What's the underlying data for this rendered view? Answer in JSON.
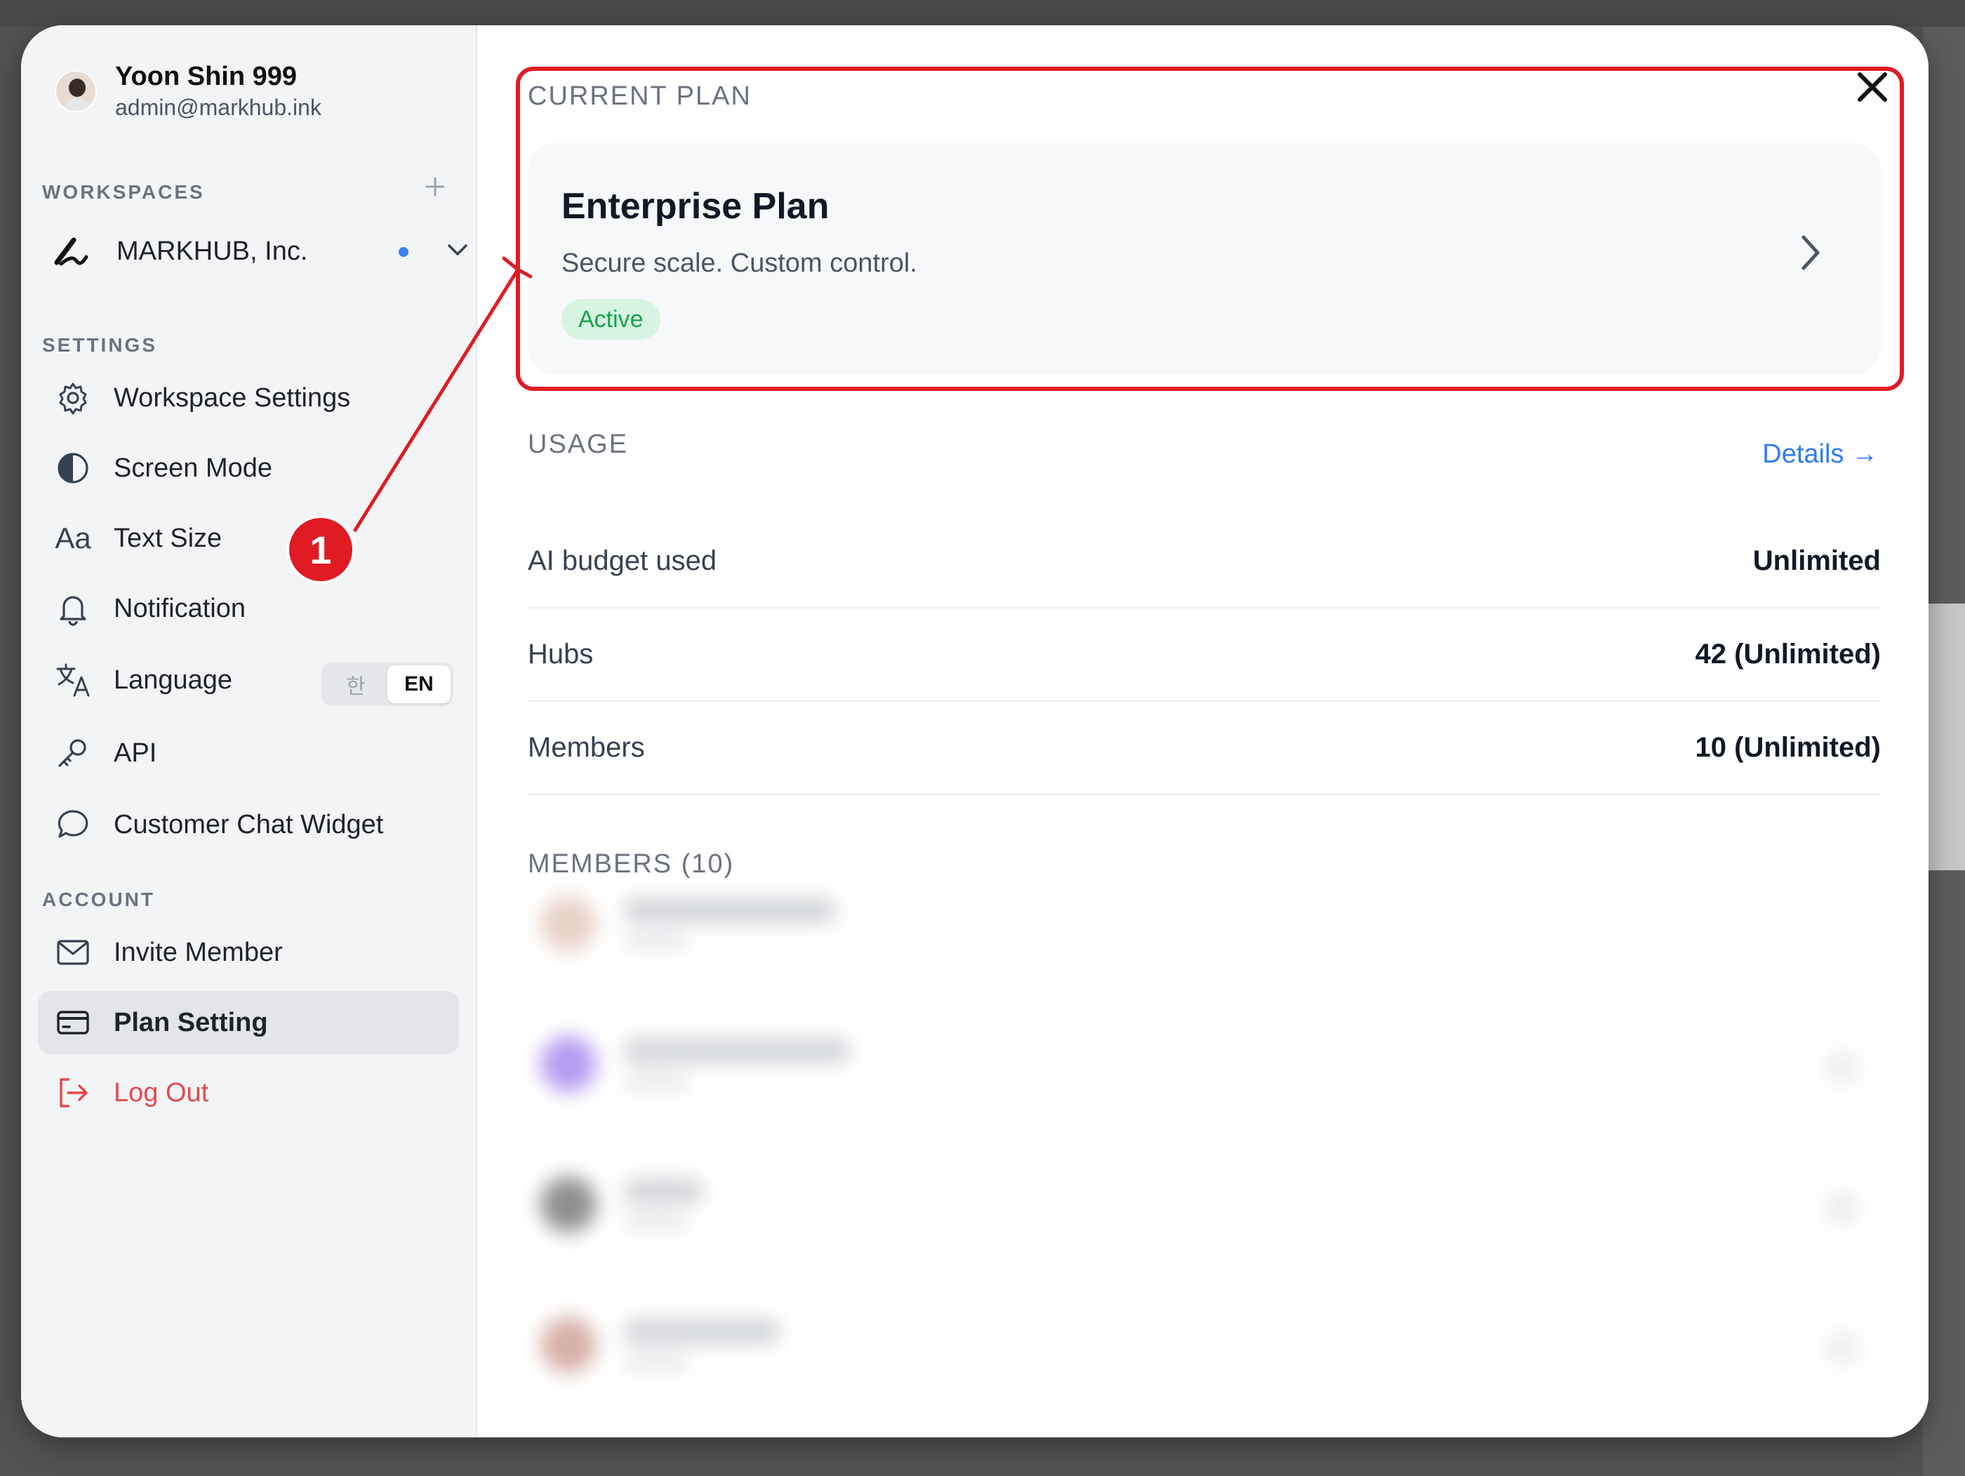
{
  "profile": {
    "name": "Yoon Shin 999",
    "email": "admin@markhub.ink"
  },
  "sidebar": {
    "workspaces_label": "WORKSPACES",
    "workspace_name": "MARKHUB, Inc.",
    "settings_label": "SETTINGS",
    "settings_items": [
      {
        "label": "Workspace Settings",
        "icon": "gear-icon"
      },
      {
        "label": "Screen Mode",
        "icon": "contrast-icon"
      },
      {
        "label": "Text Size",
        "icon": "text-size-icon"
      },
      {
        "label": "Notification",
        "icon": "bell-icon"
      },
      {
        "label": "Language",
        "icon": "translate-icon"
      },
      {
        "label": "API",
        "icon": "key-icon"
      },
      {
        "label": "Customer Chat Widget",
        "icon": "chat-bubble-icon"
      }
    ],
    "language_options": [
      "한",
      "EN"
    ],
    "language_selected": "EN",
    "text_size_glyph": "Aa",
    "account_label": "ACCOUNT",
    "account_items": [
      {
        "label": "Invite Member",
        "icon": "envelope-icon"
      },
      {
        "label": "Plan Setting",
        "icon": "credit-card-icon",
        "active": true
      },
      {
        "label": "Log Out",
        "icon": "logout-icon"
      }
    ]
  },
  "main": {
    "current_plan_label": "CURRENT PLAN",
    "plan": {
      "title": "Enterprise Plan",
      "subtitle": "Secure scale. Custom control.",
      "status": "Active"
    },
    "usage_label": "USAGE",
    "details_link": "Details →",
    "usage_rows": [
      {
        "label": "AI budget used",
        "value": "Unlimited"
      },
      {
        "label": "Hubs",
        "value": "42 (Unlimited)"
      },
      {
        "label": "Members",
        "value": "10 (Unlimited)"
      }
    ],
    "members_label": "MEMBERS (10)"
  },
  "annotation": {
    "step_number": "1",
    "color": "#e01b24"
  },
  "colors": {
    "accent": "#2f7bf5",
    "active_badge_bg": "#d7f4e3",
    "active_badge_text": "#16a34a",
    "logout": "#e5484d"
  }
}
